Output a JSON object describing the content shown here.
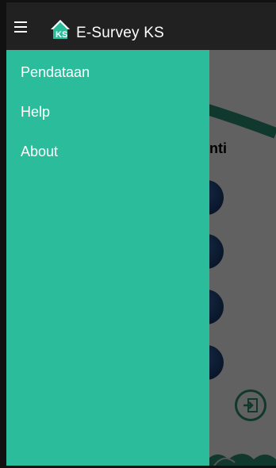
{
  "app": {
    "title": "E-Survey KS"
  },
  "icons": {
    "menu": "hamburger-menu-icon",
    "logo": "house-ks-logo-icon",
    "exit": "exit-door-icon"
  },
  "drawer": {
    "items": [
      {
        "label": "Pendataan"
      },
      {
        "label": "Help"
      },
      {
        "label": "About"
      }
    ]
  },
  "background": {
    "partial_heading": "nti"
  },
  "colors": {
    "appbar": "#212121",
    "drawer": "#2bbc9b",
    "accent_dark": "#2e9477",
    "button_blue": "#1c3e72"
  }
}
